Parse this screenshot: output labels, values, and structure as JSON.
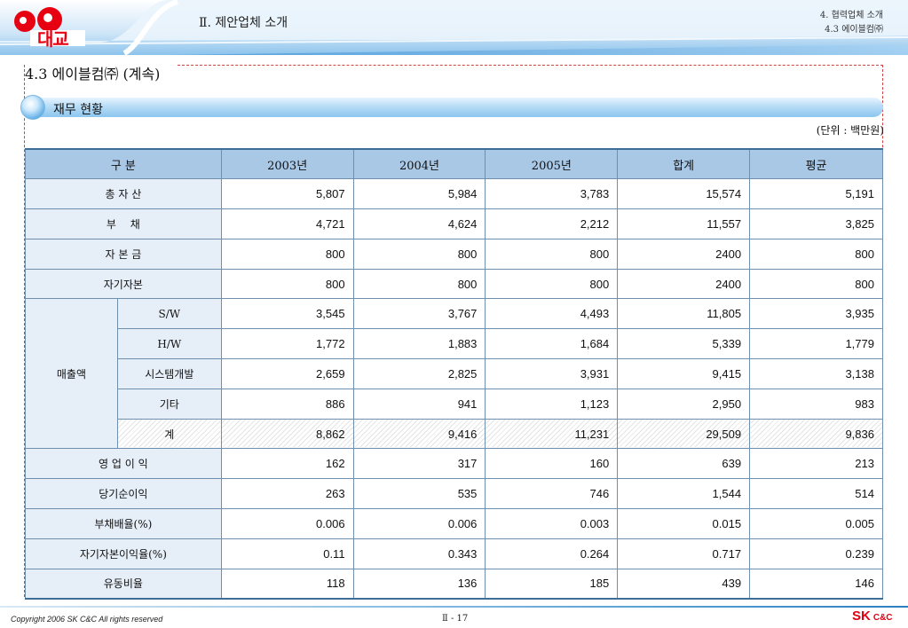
{
  "header": {
    "logo_text": "대교",
    "title": "Ⅱ. 제안업체 소개",
    "right_line1": "4. 협력업체 소개",
    "right_line2": "4.3 에이블컴㈜"
  },
  "section": {
    "title": "4.3 에이블컴㈜ (계속)",
    "subsection": "재무 현황",
    "unit": "(단위 : 백만원)"
  },
  "table": {
    "headers": [
      "구 분",
      "2003년",
      "2004년",
      "2005년",
      "합계",
      "평균"
    ],
    "rows": [
      {
        "label": "총 자 산",
        "values": [
          "5,807",
          "5,984",
          "3,783",
          "15,574",
          "5,191"
        ]
      },
      {
        "label": "부　 채",
        "values": [
          "4,721",
          "4,624",
          "2,212",
          "11,557",
          "3,825"
        ]
      },
      {
        "label": "자 본 금",
        "values": [
          "800",
          "800",
          "800",
          "2400",
          "800"
        ]
      },
      {
        "label": "자기자본",
        "values": [
          "800",
          "800",
          "800",
          "2400",
          "800"
        ]
      }
    ],
    "sales": {
      "label": "매출액",
      "rows": [
        {
          "label": "S/W",
          "values": [
            "3,545",
            "3,767",
            "4,493",
            "11,805",
            "3,935"
          ]
        },
        {
          "label": "H/W",
          "values": [
            "1,772",
            "1,883",
            "1,684",
            "5,339",
            "1,779"
          ]
        },
        {
          "label": "시스템개발",
          "values": [
            "2,659",
            "2,825",
            "3,931",
            "9,415",
            "3,138"
          ]
        },
        {
          "label": "기타",
          "values": [
            "886",
            "941",
            "1,123",
            "2,950",
            "983"
          ]
        },
        {
          "label": "계",
          "values": [
            "8,862",
            "9,416",
            "11,231",
            "29,509",
            "9,836"
          ]
        }
      ]
    },
    "rows_after": [
      {
        "label": "영 업 이 익",
        "values": [
          "162",
          "317",
          "160",
          "639",
          "213"
        ]
      },
      {
        "label": "당기순이익",
        "values": [
          "263",
          "535",
          "746",
          "1,544",
          "514"
        ]
      },
      {
        "label": "부채배율(%)",
        "values": [
          "0.006",
          "0.006",
          "0.003",
          "0.015",
          "0.005"
        ]
      },
      {
        "label": "자기자본이익율(%)",
        "values": [
          "0.11",
          "0.343",
          "0.264",
          "0.717",
          "0.239"
        ]
      },
      {
        "label": "유동비율",
        "values": [
          "118",
          "136",
          "185",
          "439",
          "146"
        ]
      }
    ]
  },
  "footer": {
    "copyright": "Copyright 2006 SK C&C All rights reserved",
    "page": "Ⅱ - 17",
    "logo_main": "SK",
    "logo_sub": "C&C"
  },
  "colors": {
    "header_blue": "#3d8fd1",
    "table_header": "#a9c8e6",
    "label_bg": "#e6eef8",
    "brand_red": "#e60012"
  }
}
